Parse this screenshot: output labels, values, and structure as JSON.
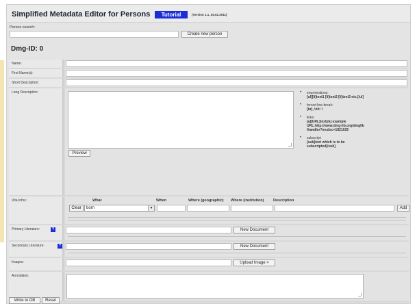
{
  "header": {
    "title": "Simplified Metadata Editor for Persons",
    "tutorial_label": "Tutorial",
    "version": "(Version 1.1, 25.02.2011)"
  },
  "search": {
    "label": "Person search:",
    "value": "",
    "create_label": "Create new person"
  },
  "dmg_id": "Dmg-ID: 0",
  "fields": {
    "name_label": "Name:",
    "first_names_label": "First Name(s):",
    "short_desc_label": "Short Description:",
    "long_desc_label": "Long Description:",
    "preview_label": "Preview"
  },
  "help": {
    "items": [
      {
        "title": "enumerations:",
        "body": "[ul][li]text1 [li]text2 [li]text3 etc.[/ul]"
      },
      {
        "title": "forced line break:",
        "body": "[br], \\n\\t: \\"
      },
      {
        "title": "links:",
        "body": "[a][URL]text[/a] example URL:http://www.dmg-lib.org/dmglib /handler?mcdoc=1821025"
      },
      {
        "title": "subscript:",
        "body": "[sub]text which is to be subscripted[/sub]"
      }
    ]
  },
  "vita": {
    "label": "Vita Infos:",
    "col_what": "What",
    "col_when": "When",
    "col_where_geo": "Where (geographic)",
    "col_where_inst": "Where (institution)",
    "col_description": "Description",
    "clear_label": "Clear",
    "what_value": "born",
    "add_label": "Add"
  },
  "literature": {
    "primary_label": "Primary Literature:",
    "secondary_label": "Secondary Literature:",
    "new_document_label": "New Document",
    "info_symbol": "?"
  },
  "images": {
    "label": "Images:",
    "upload_label": "Upload Image >"
  },
  "annotation": {
    "label": "Annotation:"
  },
  "footer": {
    "write_label": "Write to DB",
    "reset_label": "Reset"
  },
  "colors": {
    "accent": "#1a2dd6",
    "background": "#e4e4e4"
  }
}
